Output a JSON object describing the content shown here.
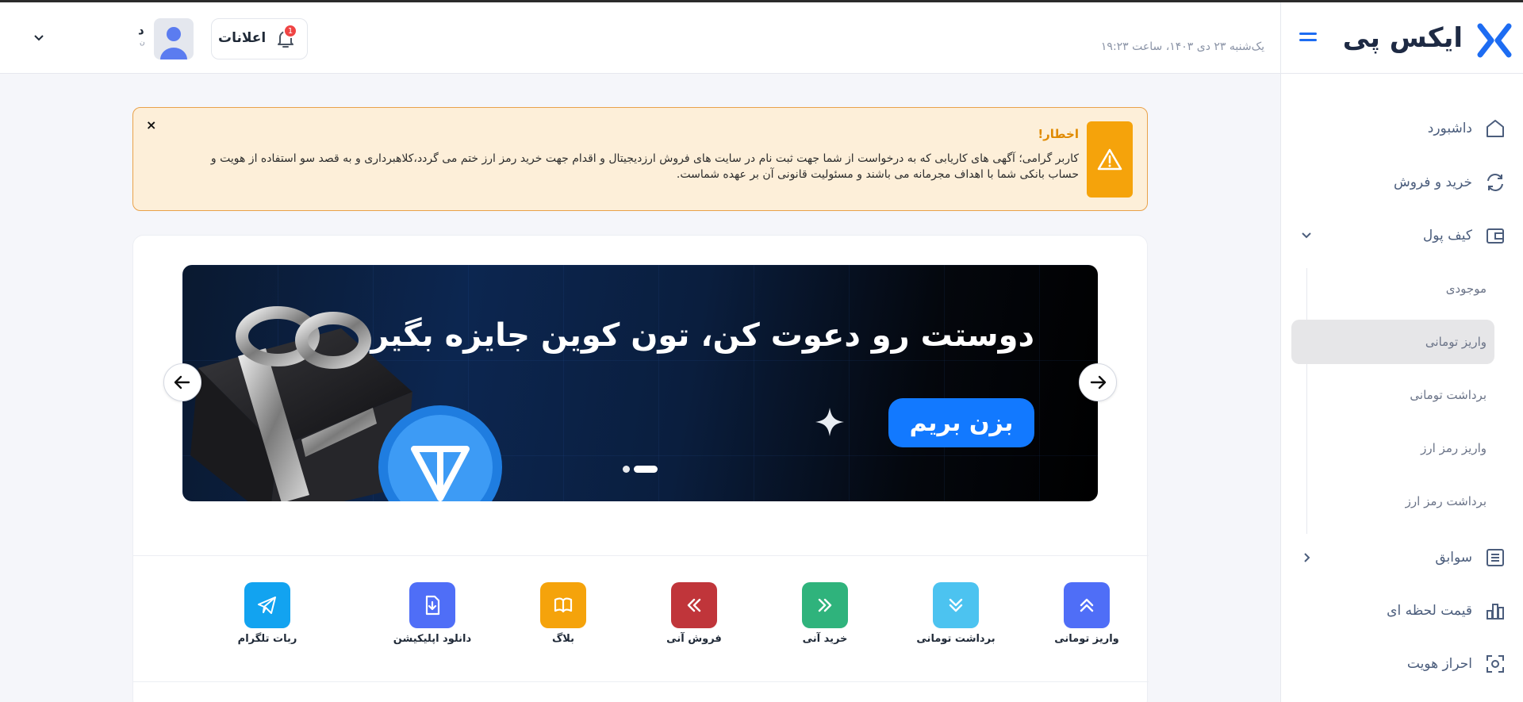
{
  "brand": {
    "name": "ایکس پی"
  },
  "header": {
    "date": "یک‌شنبه ۲۳ دی ۱۴۰۳، ساعت ۱۹:۲۳",
    "notifications_label": "اعلانات",
    "notifications_count": "1",
    "user_initial": "د",
    "user_sub": "ن"
  },
  "sidebar": {
    "items": [
      {
        "label": "داشبورد",
        "icon": "home-icon"
      },
      {
        "label": "خرید و فروش",
        "icon": "exchange-icon"
      },
      {
        "label": "کیف پول",
        "icon": "wallet-icon"
      },
      {
        "label": "سوابق",
        "icon": "history-icon"
      },
      {
        "label": "قیمت لحظه ای",
        "icon": "chart-icon"
      },
      {
        "label": "احراز هویت",
        "icon": "scan-icon"
      }
    ],
    "wallet_sub": [
      {
        "label": "موجودی"
      },
      {
        "label": "واریز تومانی"
      },
      {
        "label": "برداشت تومانی"
      },
      {
        "label": "واریز رمز ارز"
      },
      {
        "label": "برداشت رمز ارز"
      }
    ]
  },
  "alert": {
    "title": "اخطار!",
    "body": "کاربر گرامی؛ آگهی های کاریابی که به درخواست از شما جهت ثبت نام در سایت های فروش ارزدیجیتال و اقدام جهت خرید رمز ارز ختم می گردد،کلاهبرداری و به قصد سو استفاده از هویت و حساب بانکی شما با اهداف مجرمانه می باشند و مسئولیت قانونی آن بر عهده شماست.",
    "close": "×"
  },
  "banner": {
    "title": "دوستت رو دعوت کن، تون کوین جایزه بگیر",
    "button": "بزن بریم"
  },
  "actions": [
    {
      "label": "واریز تومانی",
      "icon": "double-chevron-up-icon",
      "color": "#4f6ef7"
    },
    {
      "label": "برداشت تومانی",
      "icon": "double-chevron-down-icon",
      "color": "#4cc3f0"
    },
    {
      "label": "خرید آنی",
      "icon": "double-chevron-right-icon",
      "color": "#2fb37c"
    },
    {
      "label": "فروش آنی",
      "icon": "double-chevron-left-icon",
      "color": "#c0353a"
    },
    {
      "label": "بلاگ",
      "icon": "book-icon",
      "color": "#f5a30b"
    },
    {
      "label": "دانلود اپلیکیشن",
      "icon": "download-file-icon",
      "color": "#4f6ef7"
    },
    {
      "label": "ربات تلگرام",
      "icon": "telegram-icon",
      "color": "#12a3f0"
    }
  ],
  "colors": {
    "primary": "#1d6cf2",
    "warning": "#f5a30b",
    "sidebar_text": "#4b5d7c"
  }
}
